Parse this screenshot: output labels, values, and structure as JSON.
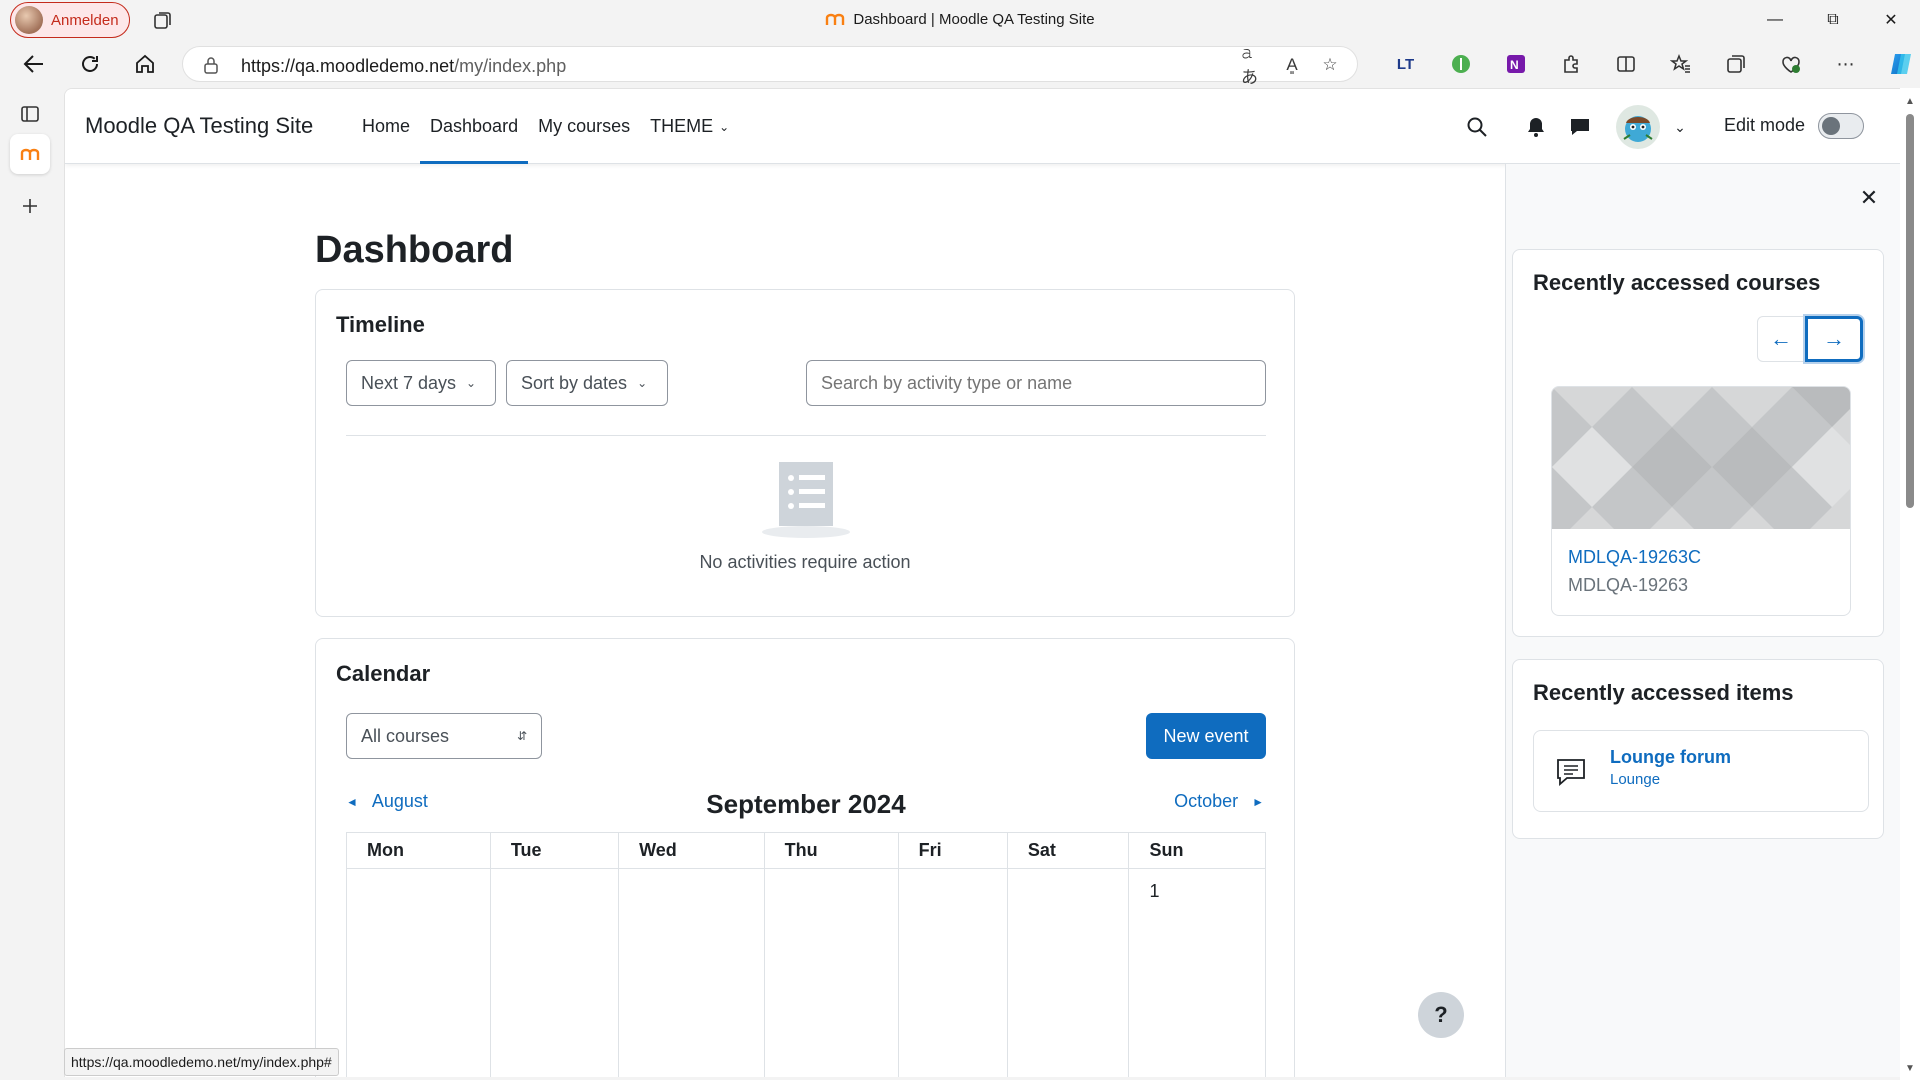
{
  "browser": {
    "profile_label": "Anmelden",
    "tab_title": "Dashboard | Moodle QA Testing Site",
    "url_host": "https://qa.moodledemo.net",
    "url_path": "/my/index.php",
    "status_url": "https://qa.moodledemo.net/my/index.php#"
  },
  "navbar": {
    "brand": "Moodle QA Testing Site",
    "items": [
      {
        "label": "Home"
      },
      {
        "label": "Dashboard"
      },
      {
        "label": "My courses"
      },
      {
        "label": "THEME"
      }
    ],
    "edit_mode_label": "Edit mode"
  },
  "main": {
    "page_title": "Dashboard",
    "timeline": {
      "title": "Timeline",
      "filter_days": "Next 7 days",
      "sort": "Sort by dates",
      "search_placeholder": "Search by activity type or name",
      "empty_text": "No activities require action"
    },
    "calendar": {
      "title": "Calendar",
      "course_filter": "All courses",
      "new_event": "New event",
      "prev_month": "August",
      "current_month": "September 2024",
      "next_month": "October",
      "days": [
        "Mon",
        "Tue",
        "Wed",
        "Thu",
        "Fri",
        "Sat",
        "Sun"
      ],
      "first_day": "1"
    }
  },
  "drawer": {
    "recent_courses": {
      "title": "Recently accessed courses",
      "course_name": "MDLQA-19263C",
      "course_category": "MDLQA-19263"
    },
    "recent_items": {
      "title": "Recently accessed items",
      "item_name": "Lounge forum",
      "item_sub": "Lounge"
    }
  },
  "help_label": "?"
}
